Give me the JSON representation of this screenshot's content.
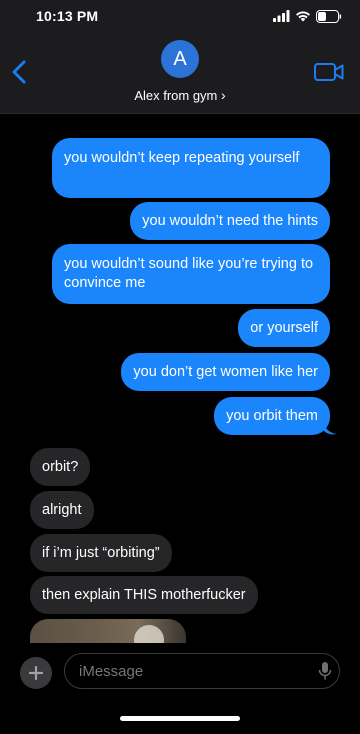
{
  "status_bar": {
    "time": "10:13 PM"
  },
  "header": {
    "avatar_initial": "A",
    "contact_name": "Alex from gym",
    "contact_chevron": "›"
  },
  "messages": [
    {
      "from": "me",
      "text": "you wouldn’t keep repeating yourself"
    },
    {
      "from": "me",
      "text": "you wouldn’t need the hints"
    },
    {
      "from": "me",
      "text": "you wouldn’t sound like you’re trying to convince me"
    },
    {
      "from": "me",
      "text": "or yourself"
    },
    {
      "from": "me",
      "text": "you don’t get women like her"
    },
    {
      "from": "me",
      "text": "you orbit them"
    },
    {
      "from": "them",
      "text": "orbit?"
    },
    {
      "from": "them",
      "text": "alright"
    },
    {
      "from": "them",
      "text": "if i’m just “orbiting”"
    },
    {
      "from": "them",
      "text": "then explain THIS motherfucker"
    }
  ],
  "input": {
    "placeholder": "iMessage"
  },
  "colors": {
    "outgoing": "#1b86fb",
    "incoming": "#262628",
    "accent": "#1e7cf2"
  },
  "icons": {
    "back": "chevron-left-icon",
    "facetime": "video-camera-icon",
    "plus": "plus-icon",
    "mic": "microphone-icon"
  }
}
